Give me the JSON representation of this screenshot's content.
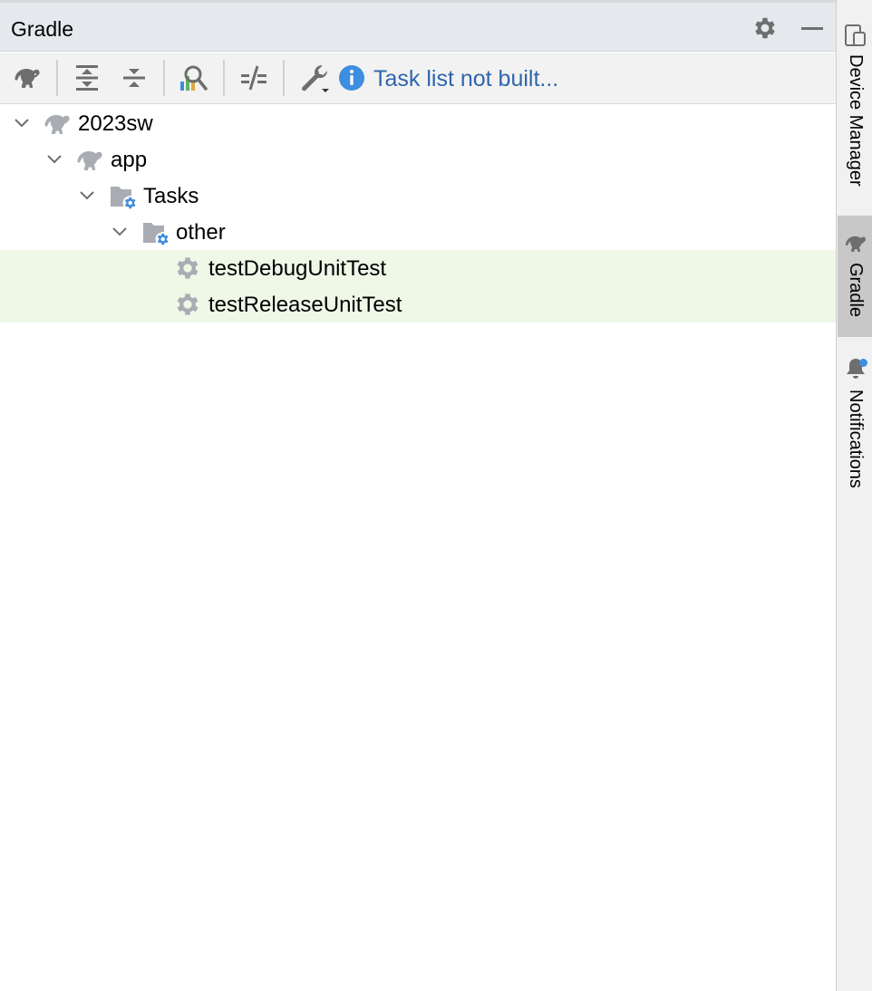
{
  "panel": {
    "title": "Gradle",
    "header_icons": [
      "gear-icon",
      "minimize-icon"
    ]
  },
  "toolbar": {
    "icons": [
      "gradle-reload-icon",
      "expand-all-icon",
      "collapse-all-icon",
      "analyze-dependencies-icon",
      "toggle-offline-icon",
      "build-tool-settings-icon"
    ],
    "info_icon": "info-icon",
    "info_text": "Task list not built..."
  },
  "tree": {
    "nodes": [
      {
        "label": "2023sw",
        "icon": "gradle-elephant-icon",
        "expanded": true,
        "selected": false
      },
      {
        "label": "app",
        "icon": "gradle-elephant-icon",
        "expanded": true,
        "selected": false
      },
      {
        "label": "Tasks",
        "icon": "task-folder-icon",
        "expanded": true,
        "selected": false
      },
      {
        "label": "other",
        "icon": "task-folder-icon",
        "expanded": true,
        "selected": false
      },
      {
        "label": "testDebugUnitTest",
        "icon": "task-gear-icon",
        "expanded": null,
        "selected": true
      },
      {
        "label": "testReleaseUnitTest",
        "icon": "task-gear-icon",
        "expanded": null,
        "selected": true
      }
    ]
  },
  "right_stripe": {
    "items": [
      {
        "label": "Device Manager",
        "icon": "device-manager-icon",
        "active": false
      },
      {
        "label": "Gradle",
        "icon": "gradle-elephant-icon",
        "active": true
      },
      {
        "label": "Notifications",
        "icon": "bell-icon",
        "active": false,
        "has_badge": true
      }
    ]
  },
  "colors": {
    "header_bg": "#e5e8ec",
    "toolbar_bg": "#f2f2f2",
    "selection_bg": "#eff7e6",
    "info_blue": "#3d8ee0",
    "link_text": "#2f65ad",
    "icon_gray": "#6e6e6e",
    "folder_gray": "#a9adb3"
  }
}
